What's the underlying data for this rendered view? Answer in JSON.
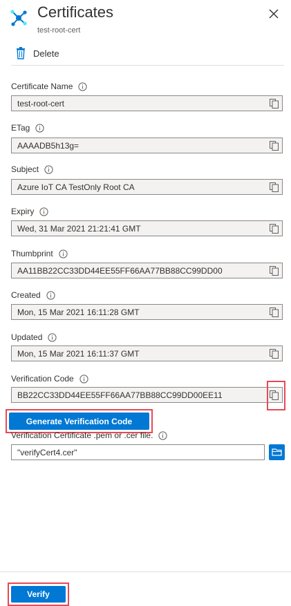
{
  "header": {
    "title": "Certificates",
    "subtitle": "test-root-cert",
    "app_icon": "iot-hub-icon",
    "close_icon": "close-icon"
  },
  "toolbar": {
    "delete_label": "Delete",
    "delete_icon": "trash-icon"
  },
  "fields": [
    {
      "label": "Certificate Name",
      "value": "test-root-cert"
    },
    {
      "label": "ETag",
      "value": "AAAADB5h13g="
    },
    {
      "label": "Subject",
      "value": "Azure IoT CA TestOnly Root CA"
    },
    {
      "label": "Expiry",
      "value": "Wed, 31 Mar 2021 21:21:41 GMT"
    },
    {
      "label": "Thumbprint",
      "value": "AA11BB22CC33DD44EE55FF66AA77BB88CC99DD00"
    },
    {
      "label": "Created",
      "value": "Mon, 15 Mar 2021 16:11:28 GMT"
    },
    {
      "label": "Updated",
      "value": "Mon, 15 Mar 2021 16:11:37 GMT"
    },
    {
      "label": "Verification Code",
      "value": "BB22CC33DD44EE55FF66AA77BB88CC99DD00EE11"
    }
  ],
  "generate_button": {
    "label": "Generate Verification Code"
  },
  "verification_file": {
    "label": "Verification Certificate .pem or .cer file.",
    "value": "\"verifyCert4.cer\"",
    "browse_icon": "folder-icon"
  },
  "footer": {
    "verify_label": "Verify"
  },
  "colors": {
    "accent": "#0078d4",
    "highlight": "#e74856",
    "readonly_bg": "#f3f2f1"
  }
}
